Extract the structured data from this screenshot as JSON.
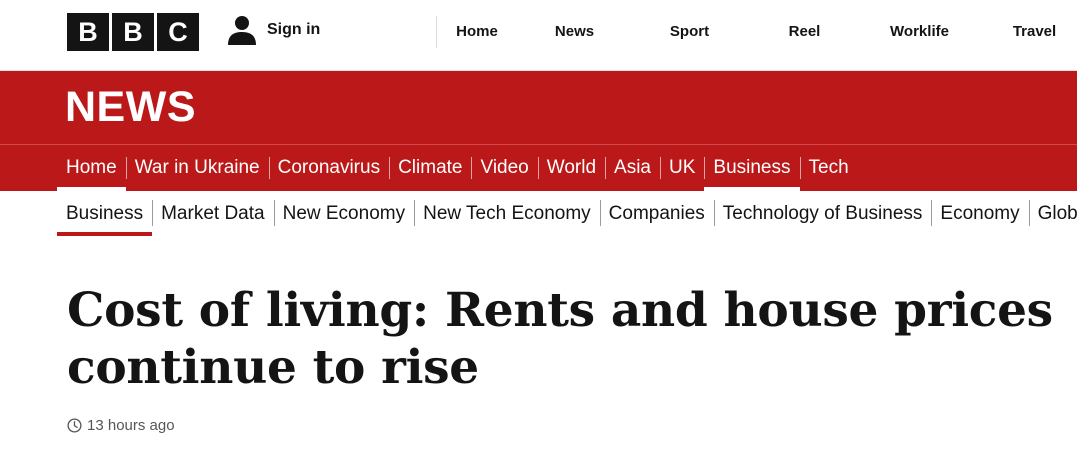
{
  "brand": {
    "logo_letters": [
      "B",
      "B",
      "C"
    ]
  },
  "account": {
    "sign_in_label": "Sign in",
    "icon": "person-icon"
  },
  "top_nav": [
    "Home",
    "News",
    "Sport",
    "Reel",
    "Worklife",
    "Travel"
  ],
  "section": {
    "title": "NEWS",
    "color": "#bb1919"
  },
  "primary_nav": {
    "items": [
      "Home",
      "War in Ukraine",
      "Coronavirus",
      "Climate",
      "Video",
      "World",
      "Asia",
      "UK",
      "Business",
      "Tech"
    ],
    "active": [
      "Home",
      "Business"
    ]
  },
  "secondary_nav": {
    "items": [
      "Business",
      "Market Data",
      "New Economy",
      "New Tech Economy",
      "Companies",
      "Technology of Business",
      "Economy",
      "Global Car Industry"
    ],
    "active": "Business"
  },
  "article": {
    "headline": "Cost of living: Rents and house prices continue to rise",
    "timestamp": "13 hours ago",
    "timestamp_icon": "clock-icon"
  }
}
